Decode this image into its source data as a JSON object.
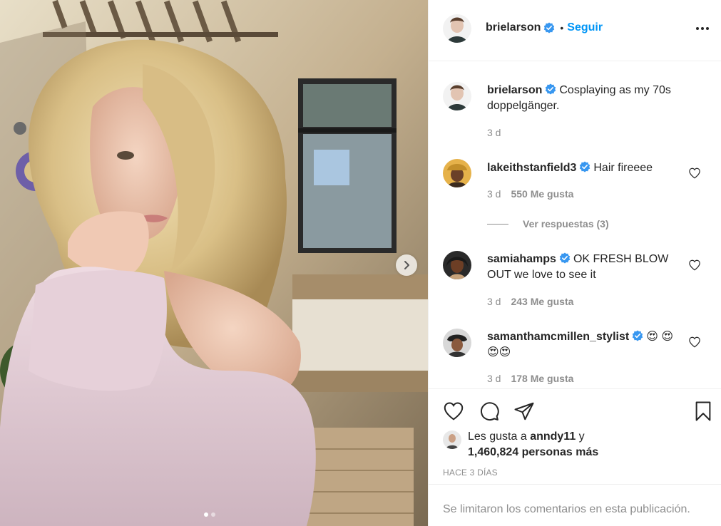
{
  "post": {
    "username": "brielarson",
    "follow_label": "Seguir",
    "separator": "•",
    "caption": "Cosplaying as my 70s doppelgänger.",
    "caption_time": "3 d"
  },
  "comments": [
    {
      "username": "lakeithstanfield3",
      "text": "Hair fireeee",
      "time": "3 d",
      "likes": "550 Me gusta",
      "verified": true
    },
    {
      "username": "samiahamps",
      "text": "OK FRESH BLOW OUT we love to see it",
      "time": "3 d",
      "likes": "243 Me gusta",
      "verified": true
    },
    {
      "username": "samanthamcmillen_stylist",
      "text": "😍 😍😍😍",
      "time": "3 d",
      "likes": "178 Me gusta",
      "verified": true
    }
  ],
  "replies_label": "Ver respuestas (3)",
  "likes": {
    "prefix": "Les gusta a",
    "user": "anndy11",
    "suffix": "y",
    "count": "1,460,824 personas más"
  },
  "time_label": "HACE 3 DÍAS",
  "comments_limited": "Se limitaron los comentarios en esta publicación.",
  "icons": {
    "verified": "verified-badge-icon",
    "like": "heart-icon",
    "comment": "comment-bubble-icon",
    "share": "paper-plane-icon",
    "save": "bookmark-icon",
    "more": "more-options-icon",
    "next": "chevron-right-icon"
  },
  "colors": {
    "link": "#0095f6",
    "verified": "#3897f0",
    "muted": "#8e8e8e"
  },
  "carousel": {
    "total": 2,
    "current": 1
  }
}
